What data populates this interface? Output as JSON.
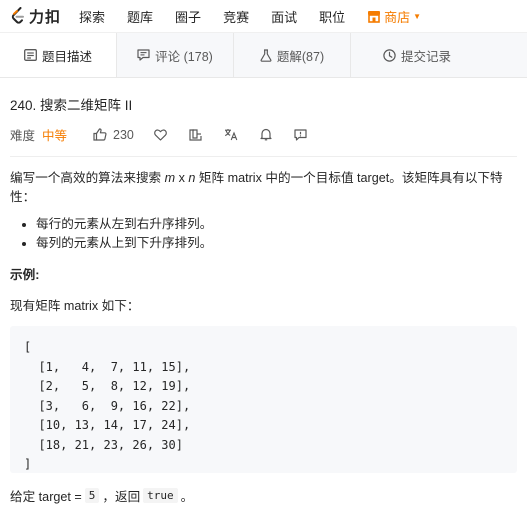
{
  "nav": {
    "logo_text": "力扣",
    "items": [
      "探索",
      "题库",
      "圈子",
      "竞赛",
      "面试",
      "职位"
    ],
    "store_label": "商店"
  },
  "tabs": [
    {
      "label": "题目描述",
      "icon": "document-icon",
      "active": true
    },
    {
      "label": "评论 (178)",
      "icon": "comment-icon",
      "active": false
    },
    {
      "label": "题解(87)",
      "icon": "flask-icon",
      "active": false
    },
    {
      "label": "提交记录",
      "icon": "clock-icon",
      "active": false
    }
  ],
  "problem": {
    "title": "240. 搜索二维矩阵 II",
    "difficulty_label": "难度",
    "difficulty": "中等",
    "likes": "230",
    "description": {
      "before": "编写一个高效的算法来搜索 ",
      "italic": "m",
      "mid1": " x ",
      "italic2": "n",
      "after": " 矩阵 matrix 中的一个目标值 target。该矩阵具有以下特性："
    },
    "properties": [
      "每行的元素从左到右升序排列。",
      "每列的元素从上到下升序排列。"
    ],
    "example_heading": "示例:",
    "example_intro": "现有矩阵 matrix 如下：",
    "matrix_code": "[\n  [1,   4,  7, 11, 15],\n  [2,   5,  8, 12, 19],\n  [3,   6,  9, 16, 22],\n  [10, 13, 14, 17, 24],\n  [18, 21, 23, 26, 30]\n]",
    "footer": {
      "prefix": "给定 target = ",
      "target_code": "5",
      "mid": "，返回 ",
      "result_code": "true",
      "suffix": "。"
    }
  },
  "colors": {
    "accent": "#f57c00",
    "tab_bg": "#f7f8fa",
    "code_bg": "#f7f8fa"
  }
}
